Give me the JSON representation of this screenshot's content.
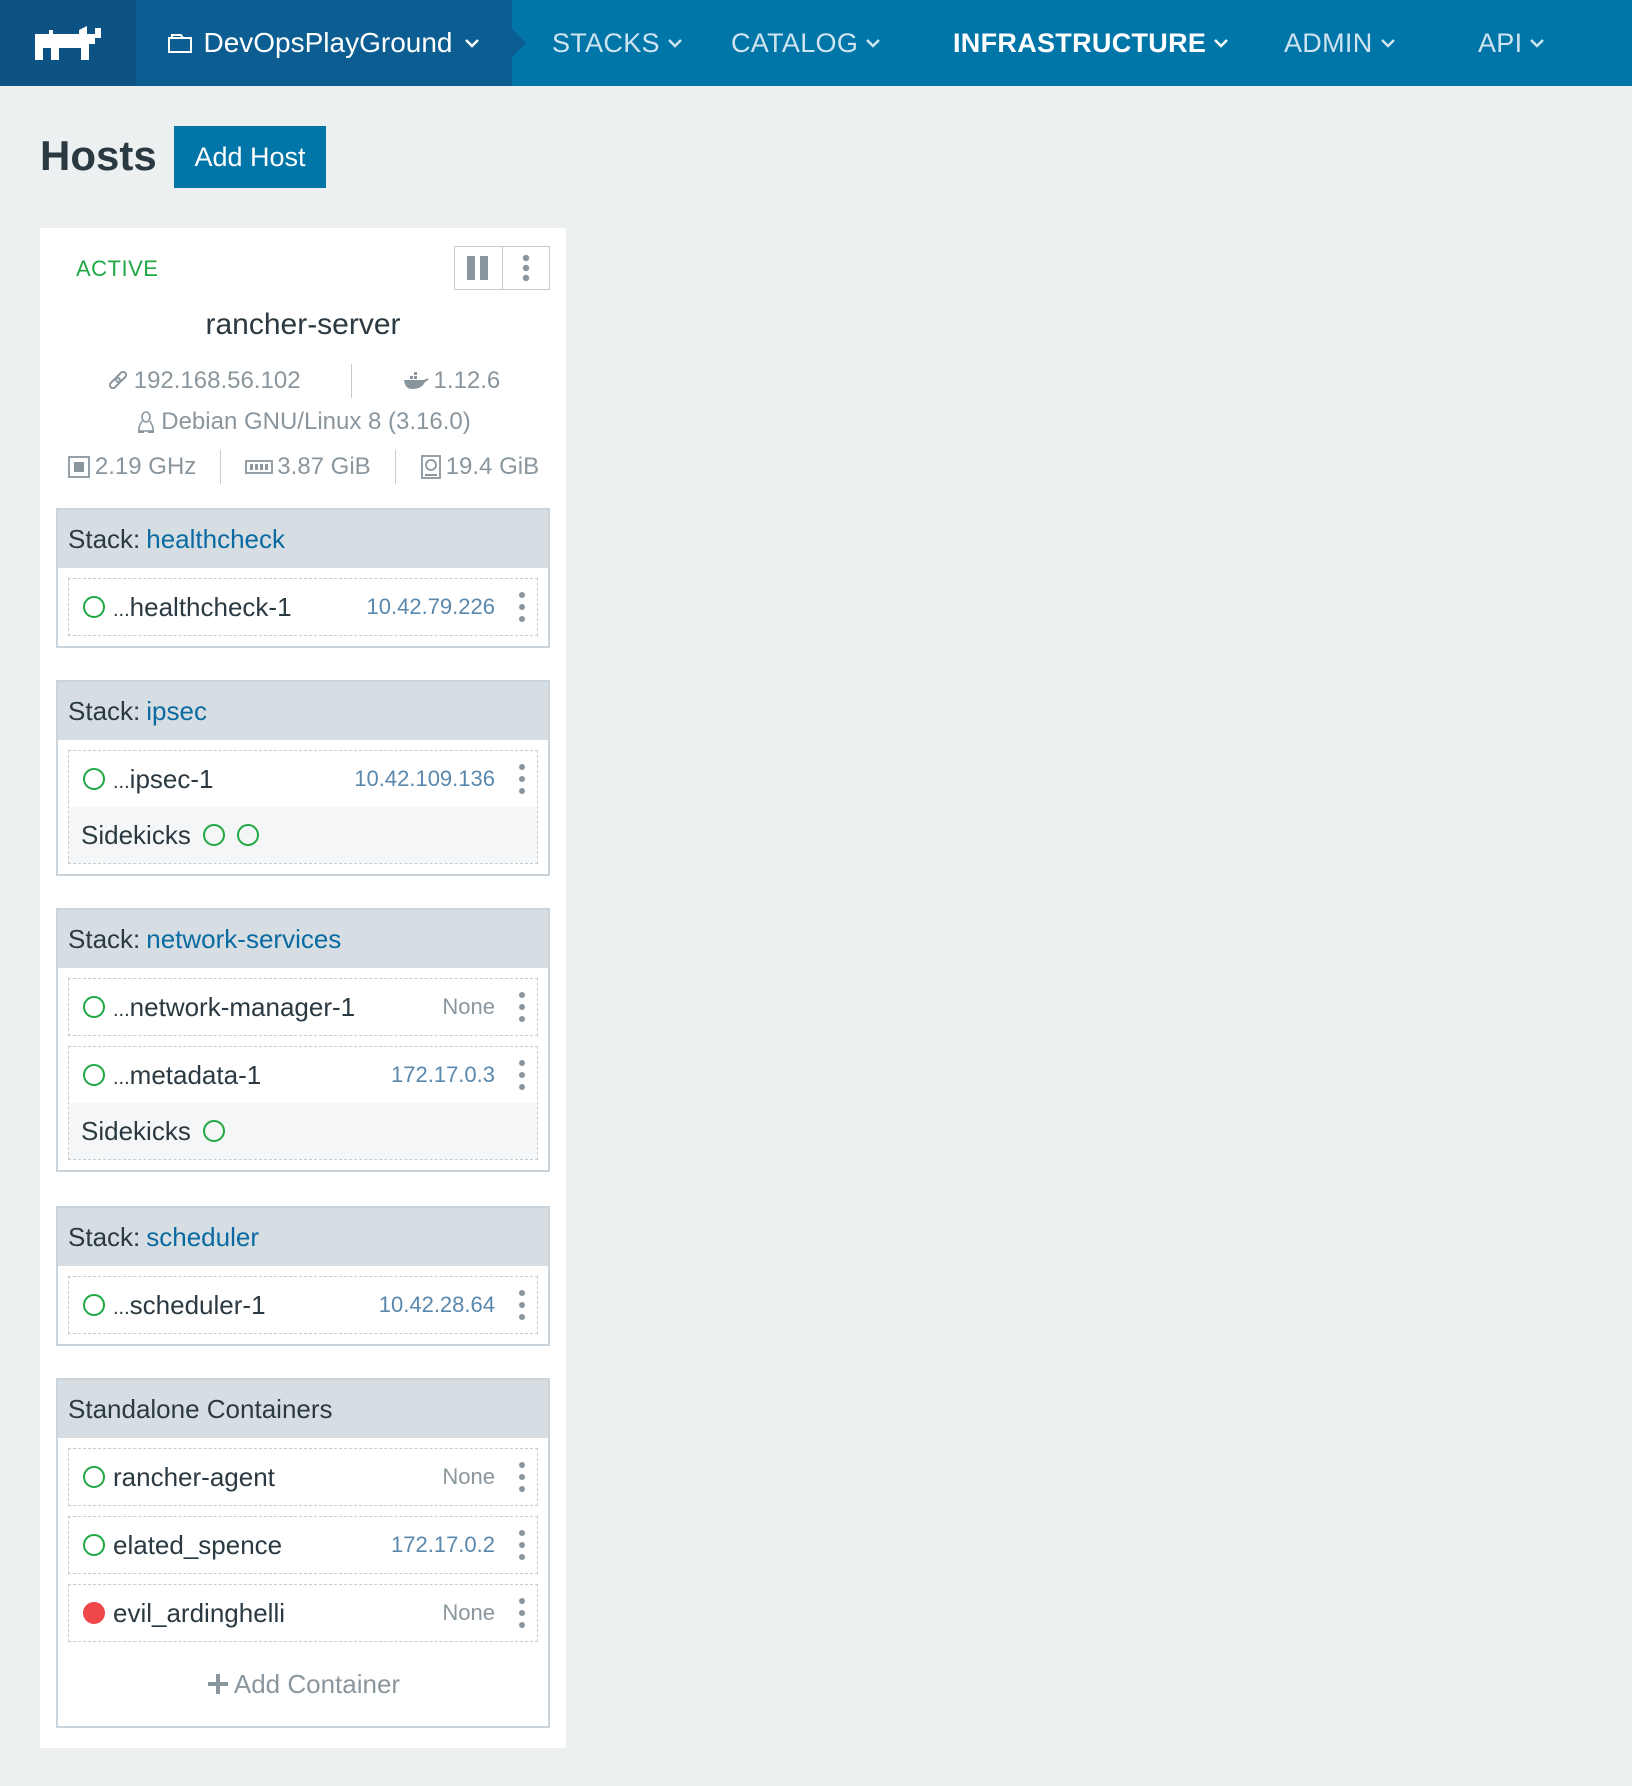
{
  "nav": {
    "environment": "DevOpsPlayGround",
    "items": [
      {
        "label": "STACKS"
      },
      {
        "label": "CATALOG"
      },
      {
        "label": "INFRASTRUCTURE"
      },
      {
        "label": "ADMIN"
      },
      {
        "label": "API"
      }
    ],
    "active": "INFRASTRUCTURE"
  },
  "page": {
    "title": "Hosts",
    "add_host_label": "Add Host"
  },
  "host": {
    "state": "ACTIVE",
    "name": "rancher-server",
    "ip": "192.168.56.102",
    "docker_version": "1.12.6",
    "os": "Debian GNU/Linux 8 (3.16.0)",
    "cpu": "2.19 GHz",
    "memory": "3.87 GiB",
    "storage": "19.4 GiB"
  },
  "stacks": [
    {
      "prefix": "Stack:",
      "name": "healthcheck",
      "containers": [
        {
          "prefix": "...",
          "name": "healthcheck-1",
          "ip": "10.42.79.226"
        }
      ]
    },
    {
      "prefix": "Stack:",
      "name": "ipsec",
      "containers": [
        {
          "prefix": "...",
          "name": "ipsec-1",
          "ip": "10.42.109.136",
          "sidekicks_label": "Sidekicks"
        }
      ]
    },
    {
      "prefix": "Stack:",
      "name": "network-services",
      "containers": [
        {
          "prefix": "...",
          "name": "network-manager-1",
          "ip": "None"
        },
        {
          "prefix": "...",
          "name": "metadata-1",
          "ip": "172.17.0.3",
          "sidekicks_label": "Sidekicks"
        }
      ]
    },
    {
      "prefix": "Stack:",
      "name": "scheduler",
      "containers": [
        {
          "prefix": "...",
          "name": "scheduler-1",
          "ip": "10.42.28.64"
        }
      ]
    }
  ],
  "standalone": {
    "title": "Standalone Containers",
    "containers": [
      {
        "name": "rancher-agent",
        "ip": "None",
        "status": "running"
      },
      {
        "name": "elated_spence",
        "ip": "172.17.0.2",
        "status": "running"
      },
      {
        "name": "evil_ardinghelli",
        "ip": "None",
        "status": "stopped"
      }
    ],
    "add_container_label": "Add Container"
  },
  "colors": {
    "nav_bg": "#0075a8",
    "running": "#1fa843",
    "stopped": "#f0474a",
    "link": "#0a6aa1"
  }
}
